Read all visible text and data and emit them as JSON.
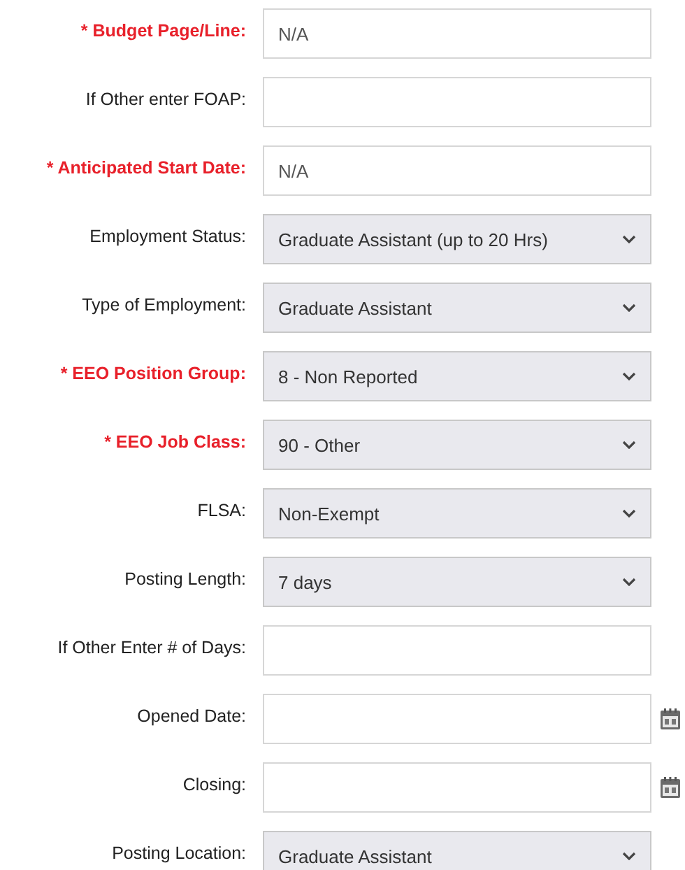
{
  "fields": [
    {
      "kind": "text",
      "label": "* Budget Page/Line:",
      "required": true,
      "value": "N/A"
    },
    {
      "kind": "text",
      "label": "If Other enter FOAP:",
      "required": false
    },
    {
      "kind": "text",
      "label": "* Anticipated Start Date:",
      "required": true,
      "value": "N/A"
    },
    {
      "kind": "select",
      "label": "Employment Status:",
      "required": false,
      "value": "Graduate Assistant (up to 20 Hrs)"
    },
    {
      "kind": "select",
      "label": "Type of Employment:",
      "required": false,
      "value": "Graduate Assistant"
    },
    {
      "kind": "select",
      "label": "* EEO Position Group:",
      "required": true,
      "value": "8 - Non Reported"
    },
    {
      "kind": "select",
      "label": "* EEO Job Class:",
      "required": true,
      "value": "90 - Other"
    },
    {
      "kind": "select",
      "label": "FLSA:",
      "required": false,
      "value": "Non-Exempt"
    },
    {
      "kind": "select",
      "label": "Posting Length:",
      "required": false,
      "value": "7 days"
    },
    {
      "kind": "text",
      "label": "If Other Enter # of Days:",
      "required": false
    },
    {
      "kind": "date",
      "label": "Opened Date:",
      "required": false
    },
    {
      "kind": "date",
      "label": "Closing:",
      "required": false
    },
    {
      "kind": "select",
      "label": "Posting Location:",
      "required": false,
      "value": "Graduate Assistant"
    }
  ]
}
